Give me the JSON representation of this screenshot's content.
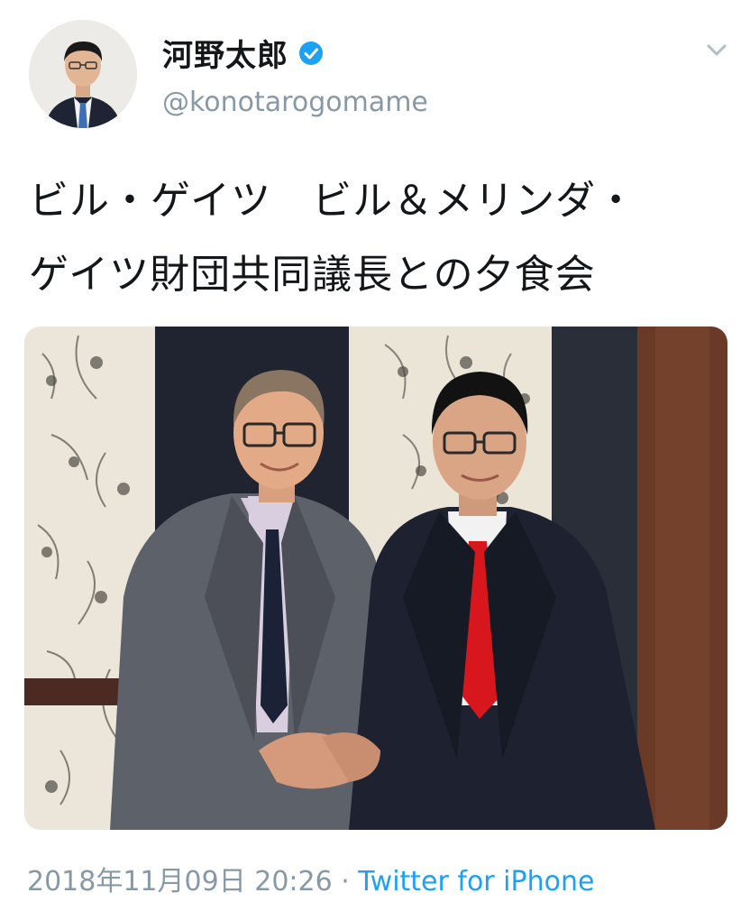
{
  "user": {
    "display_name": "河野太郎",
    "handle": "@konotarogomame",
    "verified": true,
    "avatar_icon": "profile-photo-man-suit-blue-tie"
  },
  "tweet": {
    "text_lines": [
      "ビル・ゲイツ　ビル＆メリンダ・",
      "ゲイツ財団共同議長との夕食会"
    ],
    "photo_description_icon": "photo-two-men-handshake",
    "timestamp": "2018年11月09日 20:26",
    "separator": " · ",
    "source": "Twitter for iPhone"
  },
  "colors": {
    "text": "#14171a",
    "secondary": "#8899a6",
    "link": "#1da1f2",
    "verified": "#1da1f2",
    "red_tie": "#d8161d",
    "dark_tie": "#1b2238"
  }
}
